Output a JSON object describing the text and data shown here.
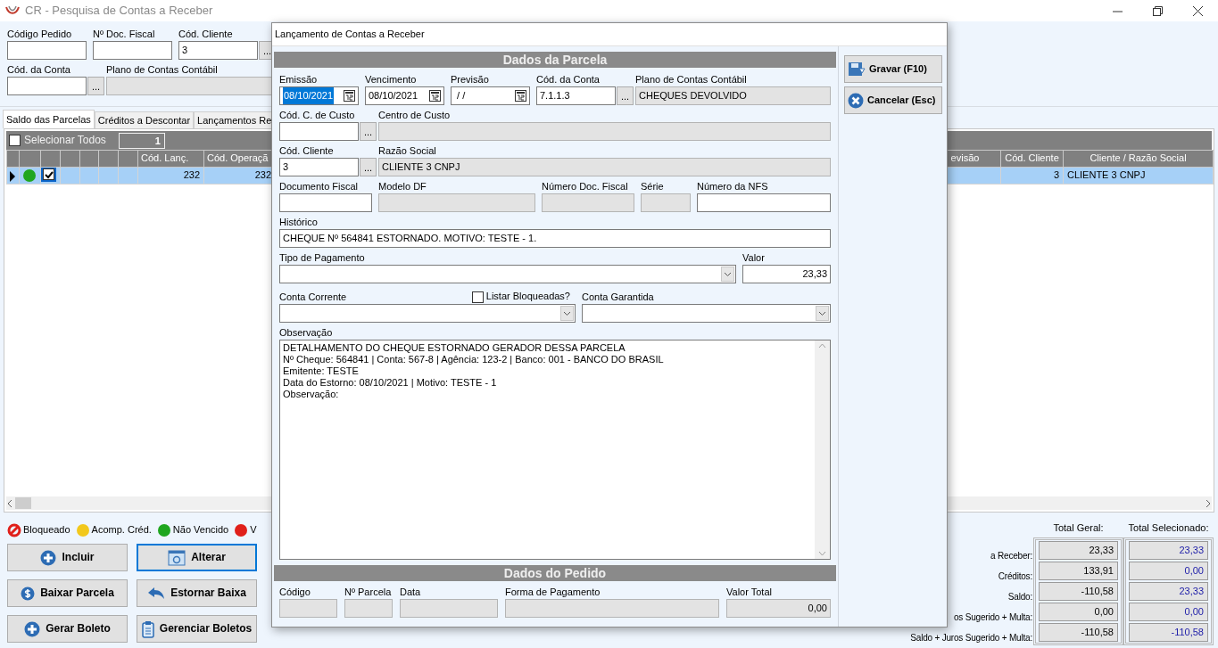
{
  "window": {
    "title": "CR - Pesquisa de Contas a Receber"
  },
  "filters": [
    [
      {
        "label": "Código Pedido",
        "kind": "text"
      },
      {
        "label": "Nº Doc. Fiscal",
        "kind": "text"
      },
      {
        "label": "Cód. Cliente",
        "kind": "lookup",
        "value": "3",
        "button": "..."
      }
    ],
    [
      {
        "label": "Cód. da Conta",
        "kind": "lookup",
        "button": "..."
      },
      {
        "label": "Plano de Contas Contábil",
        "kind": "readonly"
      }
    ]
  ],
  "tabs": [
    {
      "label": "Saldo das Parcelas",
      "selected": true
    },
    {
      "label": "Créditos a Descontar",
      "selected": false
    },
    {
      "label": "Lançamentos Re",
      "selected": false
    }
  ],
  "grid": {
    "select_all": {
      "label": "Selecionar Todos",
      "checked": false
    },
    "count": "1",
    "columns": [
      {
        "label": "Cód. Lanç."
      },
      {
        "label": "Cód. Operaçã"
      },
      {
        "label": "evisão"
      },
      {
        "label": "Cód. Cliente"
      },
      {
        "label": "Cliente / Razão Social"
      }
    ],
    "rows": [
      {
        "selected": true,
        "checked": true,
        "color": "#1fa61f",
        "cells": [
          "232",
          "232",
          null,
          "3",
          "CLIENTE 3 CNPJ"
        ]
      }
    ]
  },
  "legend": [
    {
      "kind": "blocked",
      "label": "Bloqueado",
      "color": "#e0201b"
    },
    {
      "kind": "dot",
      "label": "Acomp. Créd.",
      "color": "#f2c81c"
    },
    {
      "kind": "dot",
      "label": "Não Vencido",
      "color": "#1fa61f"
    },
    {
      "kind": "dot",
      "label": "V",
      "color": "#e0201b"
    }
  ],
  "actions": [
    {
      "label": "Incluir",
      "kind": "plus",
      "focused": false
    },
    {
      "label": "Alterar",
      "kind": "edit",
      "focused": true
    },
    {
      "label": "Baixar Parcela",
      "kind": "money",
      "focused": false
    },
    {
      "label": "Estornar Baixa",
      "kind": "undo",
      "focused": false
    },
    {
      "label": "Gerar Boleto",
      "kind": "plus",
      "focused": false
    },
    {
      "label": "Gerenciar Boletos",
      "kind": "list",
      "focused": false
    }
  ],
  "totals": {
    "headers": [
      "Total Geral:",
      "Total Selecionado:"
    ],
    "rows": [
      {
        "label": "a Receber:",
        "general": "23,33",
        "selected": "23,33"
      },
      {
        "label": "Créditos:",
        "general": "133,91",
        "selected": "0,00"
      },
      {
        "label": "Saldo:",
        "general": "-110,58",
        "selected": "23,33"
      },
      {
        "label": "os Sugerido + Multa:",
        "general": "0,00",
        "selected": "0,00"
      },
      {
        "label": "Saldo + Juros Sugerido + Multa:",
        "general": "-110,58",
        "selected": "-110,58"
      }
    ]
  },
  "dialog": {
    "title": "Lançamento de Contas a Receber",
    "parcela": {
      "header": "Dados da Parcela",
      "field_groups": [
        [
          {
            "label": "Emissão",
            "kind": "date",
            "value": "08/10/2021",
            "highlighted": true
          },
          {
            "label": "Vencimento",
            "kind": "date",
            "value": "08/10/2021",
            "highlighted": false
          },
          {
            "label": "Previsão",
            "kind": "date",
            "value": " / /",
            "highlighted": false
          },
          {
            "label": "Cód. da Conta",
            "kind": "lookup",
            "value": "7.1.1.3",
            "button": "..."
          },
          {
            "label": "Plano de Contas Contábil",
            "kind": "readonly",
            "value": "CHEQUES DEVOLVIDO"
          }
        ],
        [
          {
            "label": "Cód. C. de Custo",
            "kind": "lookup",
            "button": "..."
          },
          {
            "label": "Centro de Custo",
            "kind": "readonly"
          }
        ],
        [
          {
            "label": "Cód. Cliente",
            "kind": "lookup",
            "value": "3",
            "button": "..."
          },
          {
            "label": "Razão Social",
            "kind": "readonly",
            "value": "CLIENTE 3 CNPJ"
          }
        ],
        [
          {
            "label": "Documento Fiscal",
            "kind": "text"
          },
          {
            "label": "Modelo DF",
            "kind": "readonly"
          },
          {
            "label": "Número Doc. Fiscal",
            "kind": "readonly"
          },
          {
            "label": "Série",
            "kind": "readonly"
          },
          {
            "label": "Número da NFS",
            "kind": "text"
          }
        ],
        [
          {
            "label": "Histórico",
            "kind": "text",
            "value": "CHEQUE Nº 564841 ESTORNADO. MOTIVO: TESTE - 1."
          }
        ],
        [
          {
            "label": "Tipo de Pagamento",
            "kind": "combo"
          },
          {
            "label": "Valor",
            "kind": "money",
            "value": "23,33"
          }
        ],
        [
          {
            "label": "Conta Corrente",
            "kind": "combo",
            "option": {
              "label": "Listar Bloqueadas?",
              "checked": false
            }
          },
          {
            "label": "Conta Garantida",
            "kind": "combo"
          }
        ],
        [
          {
            "label": "Observação",
            "kind": "memo",
            "lines": [
              "DETALHAMENTO DO CHEQUE ESTORNADO GERADOR DESSA PARCELA",
              "Nº Cheque: 564841 | Conta: 567-8 | Agência: 123-2 | Banco: 001 - BANCO DO BRASIL",
              "Emitente: TESTE",
              "Data do Estorno: 08/10/2021 | Motivo: TESTE - 1",
              "Observação:"
            ]
          }
        ]
      ]
    },
    "pedido": {
      "header": "Dados do Pedido",
      "fields": [
        {
          "label": "Código",
          "kind": "readonly"
        },
        {
          "label": "Nº Parcela",
          "kind": "readonly"
        },
        {
          "label": "Data",
          "kind": "readonly"
        },
        {
          "label": "Forma de Pagamento",
          "kind": "readonly"
        },
        {
          "label": "Valor Total",
          "kind": "amount",
          "value": "0,00"
        }
      ]
    },
    "buttons": [
      {
        "label": "Gravar (F10)",
        "kind": "save"
      },
      {
        "label": "Cancelar (Esc)",
        "kind": "cancel"
      }
    ]
  }
}
